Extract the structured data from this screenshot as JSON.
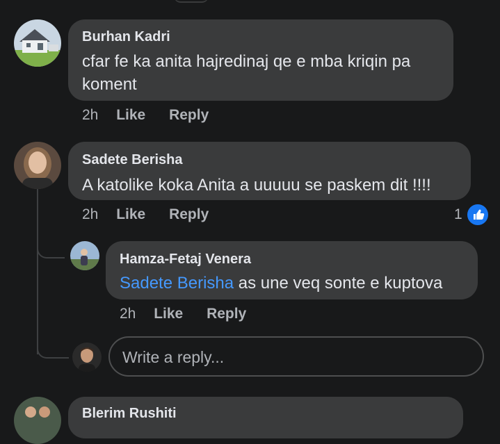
{
  "comments": [
    {
      "author": "Burhan Kadri",
      "text": "cfar fe ka anita  hajredinaj qe e mba kriqin pa koment",
      "time": "2h",
      "like_label": "Like",
      "reply_label": "Reply"
    },
    {
      "author": "Sadete Berisha",
      "text": "A katolike koka Anita a uuuuu se paskem dit !!!!",
      "time": "2h",
      "like_label": "Like",
      "reply_label": "Reply",
      "reaction_count": "1",
      "reaction_icon": "thumbs-up-icon",
      "reaction_color": "#1877f2"
    }
  ],
  "reply": {
    "author": "Hamza-Fetaj Venera",
    "mention": "Sadete Berisha",
    "text": " as une veq sonte e kuptova",
    "time": "2h",
    "like_label": "Like",
    "reply_label": "Reply"
  },
  "write_reply": {
    "placeholder": "Write a reply..."
  },
  "next_comment": {
    "author": "Blerim Rushiti"
  }
}
